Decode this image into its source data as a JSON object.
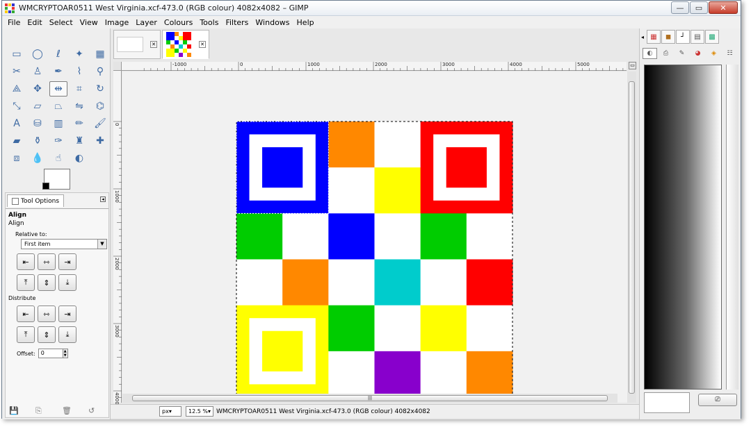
{
  "window": {
    "title": "WMCRYPTOAR0511 West Virginia.xcf-473.0 (RGB colour) 4082x4082 – GIMP",
    "buttons": {
      "minimize": "—",
      "maximize": "▭",
      "close": "✕"
    }
  },
  "menu": [
    "File",
    "Edit",
    "Select",
    "View",
    "Image",
    "Layer",
    "Colours",
    "Tools",
    "Filters",
    "Windows",
    "Help"
  ],
  "toolbox": {
    "tools": [
      {
        "name": "rect-select-icon",
        "glyph": "▭"
      },
      {
        "name": "ellipse-select-icon",
        "glyph": "◯"
      },
      {
        "name": "free-select-icon",
        "glyph": "ℓ"
      },
      {
        "name": "fuzzy-select-icon",
        "glyph": "✦"
      },
      {
        "name": "select-by-color-icon",
        "glyph": "▦"
      },
      {
        "name": "scissors-icon",
        "glyph": "✂"
      },
      {
        "name": "foreground-select-icon",
        "glyph": "♙"
      },
      {
        "name": "paths-icon",
        "glyph": "✒"
      },
      {
        "name": "color-picker-icon",
        "glyph": "⌇"
      },
      {
        "name": "zoom-icon",
        "glyph": "⚲"
      },
      {
        "name": "measure-icon",
        "glyph": "⟁"
      },
      {
        "name": "move-icon",
        "glyph": "✥"
      },
      {
        "name": "align-icon",
        "glyph": "⇹"
      },
      {
        "name": "crop-icon",
        "glyph": "⌗"
      },
      {
        "name": "rotate-icon",
        "glyph": "↻"
      },
      {
        "name": "scale-icon",
        "glyph": "⤡"
      },
      {
        "name": "shear-icon",
        "glyph": "▱"
      },
      {
        "name": "perspective-icon",
        "glyph": "⏢"
      },
      {
        "name": "flip-icon",
        "glyph": "⇋"
      },
      {
        "name": "cage-icon",
        "glyph": "⌬"
      },
      {
        "name": "text-icon",
        "glyph": "A"
      },
      {
        "name": "bucket-fill-icon",
        "glyph": "⛁"
      },
      {
        "name": "blend-icon",
        "glyph": "▥"
      },
      {
        "name": "pencil-icon",
        "glyph": "✏"
      },
      {
        "name": "paintbrush-icon",
        "glyph": "🖌"
      },
      {
        "name": "eraser-icon",
        "glyph": "▰"
      },
      {
        "name": "airbrush-icon",
        "glyph": "⚱"
      },
      {
        "name": "ink-icon",
        "glyph": "✑"
      },
      {
        "name": "clone-icon",
        "glyph": "♜"
      },
      {
        "name": "heal-icon",
        "glyph": "✚"
      },
      {
        "name": "perspective-clone-icon",
        "glyph": "⧈"
      },
      {
        "name": "blur-icon",
        "glyph": "💧"
      },
      {
        "name": "smudge-icon",
        "glyph": "☝"
      },
      {
        "name": "dodge-burn-icon",
        "glyph": "◐"
      }
    ],
    "active_tool_index": 12,
    "colors": {
      "foreground": "#000000",
      "background": "#ffffff"
    },
    "bottom_icons": [
      "save-options-icon",
      "restore-options-icon",
      "delete-options-icon",
      "reset-options-icon"
    ]
  },
  "tool_options": {
    "tab_label": "Tool Options",
    "heading": "Align",
    "subheading": "Align",
    "relative_to_label": "Relative to:",
    "relative_to_value": "First item",
    "distribute_label": "Distribute",
    "offset_label": "Offset:",
    "offset_value": "0",
    "align_buttons": [
      "⇤",
      "⇿",
      "⇥",
      "⤒",
      "⇕",
      "⤓"
    ],
    "distribute_buttons": [
      "⇤",
      "⇿",
      "⇥",
      "⤒",
      "⇕",
      "⤓"
    ]
  },
  "image_tabs": [
    {
      "name": "image-tab-blank",
      "close": "✕"
    },
    {
      "name": "image-tab-grid",
      "close": "✕"
    }
  ],
  "rulers": {
    "h_labels": [
      "-1000",
      "0",
      "1000",
      "2000",
      "3000",
      "4000",
      "5000"
    ],
    "v_labels": [
      "0",
      "1000",
      "2000",
      "3000",
      "4000"
    ]
  },
  "image": {
    "grid_cols": 6,
    "grid_rows": 6,
    "cells": [
      [
        "#0000ff",
        "#0000ff",
        "#ff8800",
        "#ffffff",
        "#ff0000",
        "#ff0000"
      ],
      [
        "#0000ff",
        "#0000ff",
        "#ffffff",
        "#ffff00",
        "#ff0000",
        "#ff0000"
      ],
      [
        "#00cc00",
        "#ffffff",
        "#0000ff",
        "#ffffff",
        "#00cc00",
        "#ffffff"
      ],
      [
        "#ffffff",
        "#ff8800",
        "#ffffff",
        "#00cccc",
        "#ffffff",
        "#ff0000"
      ],
      [
        "#ffff00",
        "#ffff00",
        "#00cc00",
        "#ffffff",
        "#ffff00",
        "#ffffff"
      ],
      [
        "#ffff00",
        "#ffff00",
        "#ffffff",
        "#8800cc",
        "#ffffff",
        "#ff8800"
      ]
    ],
    "targets": [
      {
        "name": "blue-target",
        "color": "#0000ff"
      },
      {
        "name": "red-target",
        "color": "#ff0000"
      },
      {
        "name": "yellow-target",
        "color": "#ffff00"
      }
    ]
  },
  "status": {
    "unit": "px▾",
    "zoom": "12.5 %▾",
    "text": "WMCRYPTOAR0511 West Virginia.xcf-473.0 (RGB colour) 4082x4082",
    "scroll_grip": "|||"
  },
  "right_dock": {
    "tabs": [
      {
        "name": "pattern-tab-icon",
        "glyph": "▦"
      },
      {
        "name": "brush-tab-icon",
        "glyph": "◼"
      },
      {
        "name": "gradient-tab-icon",
        "glyph": "┘"
      },
      {
        "name": "gradient-editor-tab-icon",
        "glyph": "▤"
      },
      {
        "name": "palette-tab-icon",
        "glyph": "▩"
      }
    ],
    "tabs2": [
      "◐",
      "⎙",
      "✎",
      "◕",
      "◈",
      "☷"
    ],
    "gradient": {
      "start": "#000000",
      "end": "#ffffff"
    },
    "button_glyph": "⎚"
  }
}
